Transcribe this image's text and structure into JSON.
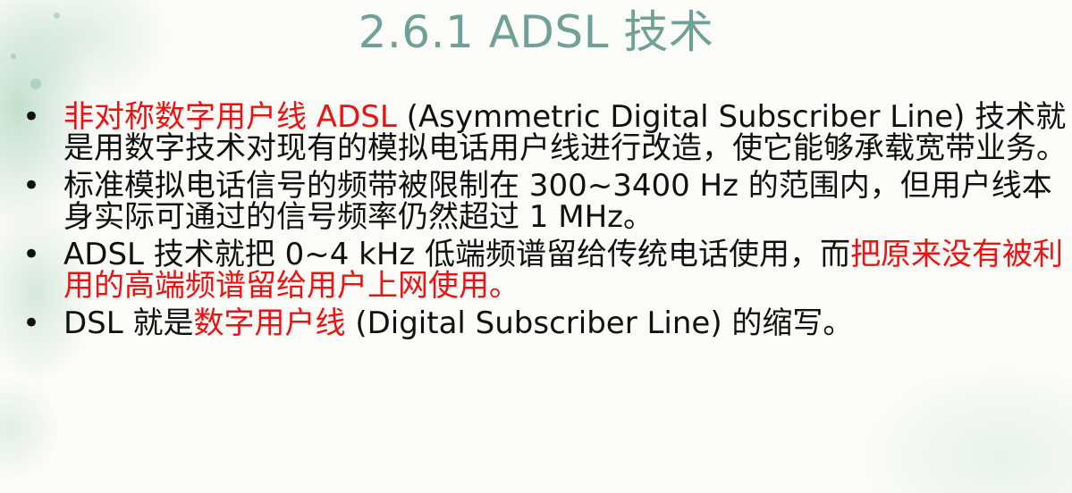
{
  "slide": {
    "title": "2.6.1  ADSL 技术",
    "bullets": [
      {
        "segments": [
          {
            "text": "非对称数字用户线 ADSL",
            "highlight": true
          },
          {
            "text": " (Asymmetric Digital Subscriber Line) 技术就是用数字技术对现有的模拟电话用户线进行改造，使它能够承载宽带业务。",
            "highlight": false
          }
        ]
      },
      {
        "segments": [
          {
            "text": "标准模拟电话信号的频带被限制在 300~3400 Hz 的范围内，但用户线本身实际可通过的信号频率仍然超过 1 MHz。",
            "highlight": false
          }
        ]
      },
      {
        "segments": [
          {
            "text": "ADSL 技术就把 0~4 kHz 低端频谱留给传统电话使用，而",
            "highlight": false
          },
          {
            "text": "把原来没有被利用的高端频谱留给用户上网使用。",
            "highlight": true
          }
        ]
      },
      {
        "segments": [
          {
            "text": "DSL 就是",
            "highlight": false
          },
          {
            "text": "数字用户线",
            "highlight": true
          },
          {
            "text": " (Digital Subscriber Line) 的缩写。",
            "highlight": false
          }
        ]
      }
    ]
  },
  "colors": {
    "title": "#6fa197",
    "body_text": "#111111",
    "highlight": "#f01010",
    "background_wash": "#96c8af"
  }
}
